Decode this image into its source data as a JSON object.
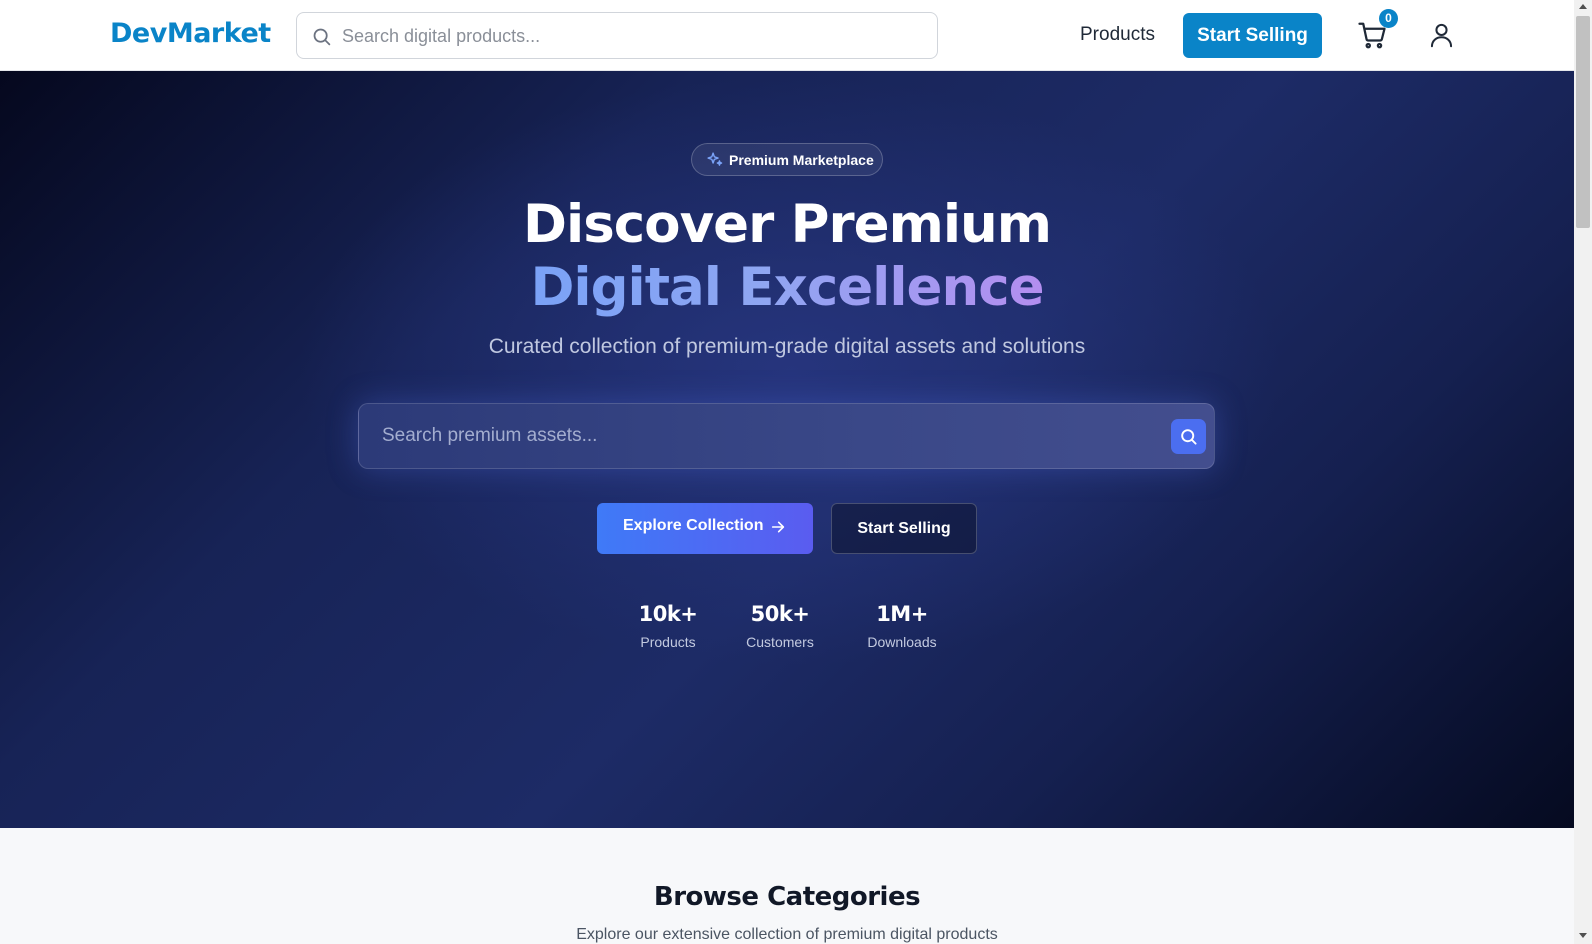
{
  "header": {
    "logo": "DevMarket",
    "search_placeholder": "Search digital products...",
    "nav_products": "Products",
    "start_selling": "Start Selling",
    "cart_count": "0",
    "icons": {
      "search": "search-icon",
      "cart": "cart-icon",
      "user": "user-icon"
    }
  },
  "hero": {
    "badge": "Premium Marketplace",
    "title_line1": "Discover Premium",
    "title_line2": "Digital Excellence",
    "subtitle": "Curated collection of premium-grade digital assets and solutions",
    "search_placeholder": "Search premium assets...",
    "primary_button": "Explore Collection",
    "secondary_button": "Start Selling",
    "stats": [
      {
        "value": "10k+",
        "label": "Products"
      },
      {
        "value": "50k+",
        "label": "Customers"
      },
      {
        "value": "1M+",
        "label": "Downloads"
      }
    ]
  },
  "categories": {
    "title": "Browse Categories",
    "subtitle": "Explore our extensive collection of premium digital products"
  },
  "colors": {
    "brand": "#0a84c8",
    "hero_accent": "#4b6ef0"
  }
}
